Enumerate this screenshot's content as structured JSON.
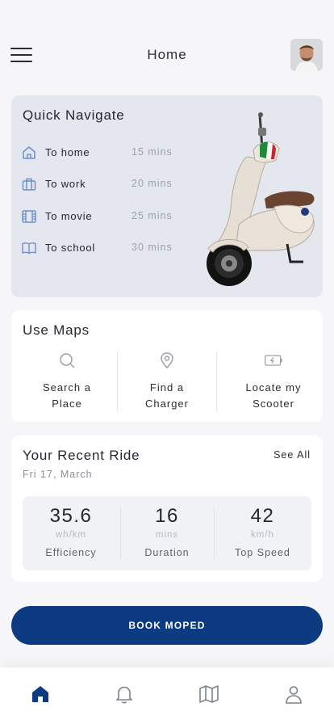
{
  "header": {
    "title": "Home"
  },
  "quick_navigate": {
    "title": "Quick Navigate",
    "items": [
      {
        "label": "To home",
        "time": "15 mins",
        "icon": "home-icon"
      },
      {
        "label": "To work",
        "time": "20 mins",
        "icon": "briefcase-icon"
      },
      {
        "label": "To movie",
        "time": "25 mins",
        "icon": "film-icon"
      },
      {
        "label": "To school",
        "time": "30 mins",
        "icon": "book-icon"
      }
    ]
  },
  "maps": {
    "title": "Use Maps",
    "options": [
      {
        "line1": "Search a",
        "line2": "Place",
        "icon": "search-icon"
      },
      {
        "line1": "Find a",
        "line2": "Charger",
        "icon": "location-pin-icon"
      },
      {
        "line1": "Locate my",
        "line2": "Scooter",
        "icon": "battery-charging-icon"
      }
    ]
  },
  "recent_ride": {
    "title": "Your Recent Ride",
    "see_all": "See All",
    "date": "Fri 17, March",
    "stats": [
      {
        "value": "35.6",
        "unit": "wh/km",
        "label": "Efficiency"
      },
      {
        "value": "16",
        "unit": "mins",
        "label": "Duration"
      },
      {
        "value": "42",
        "unit": "km/h",
        "label": "Top Speed"
      }
    ]
  },
  "book_button": "BOOK MOPED",
  "tabs": [
    {
      "icon": "home-icon",
      "active": true
    },
    {
      "icon": "bell-icon",
      "active": false
    },
    {
      "icon": "map-icon",
      "active": false
    },
    {
      "icon": "user-icon",
      "active": false
    }
  ],
  "colors": {
    "accent": "#0d3b82",
    "icon_blue": "#6d8fd0",
    "muted": "#9ba1ab"
  }
}
